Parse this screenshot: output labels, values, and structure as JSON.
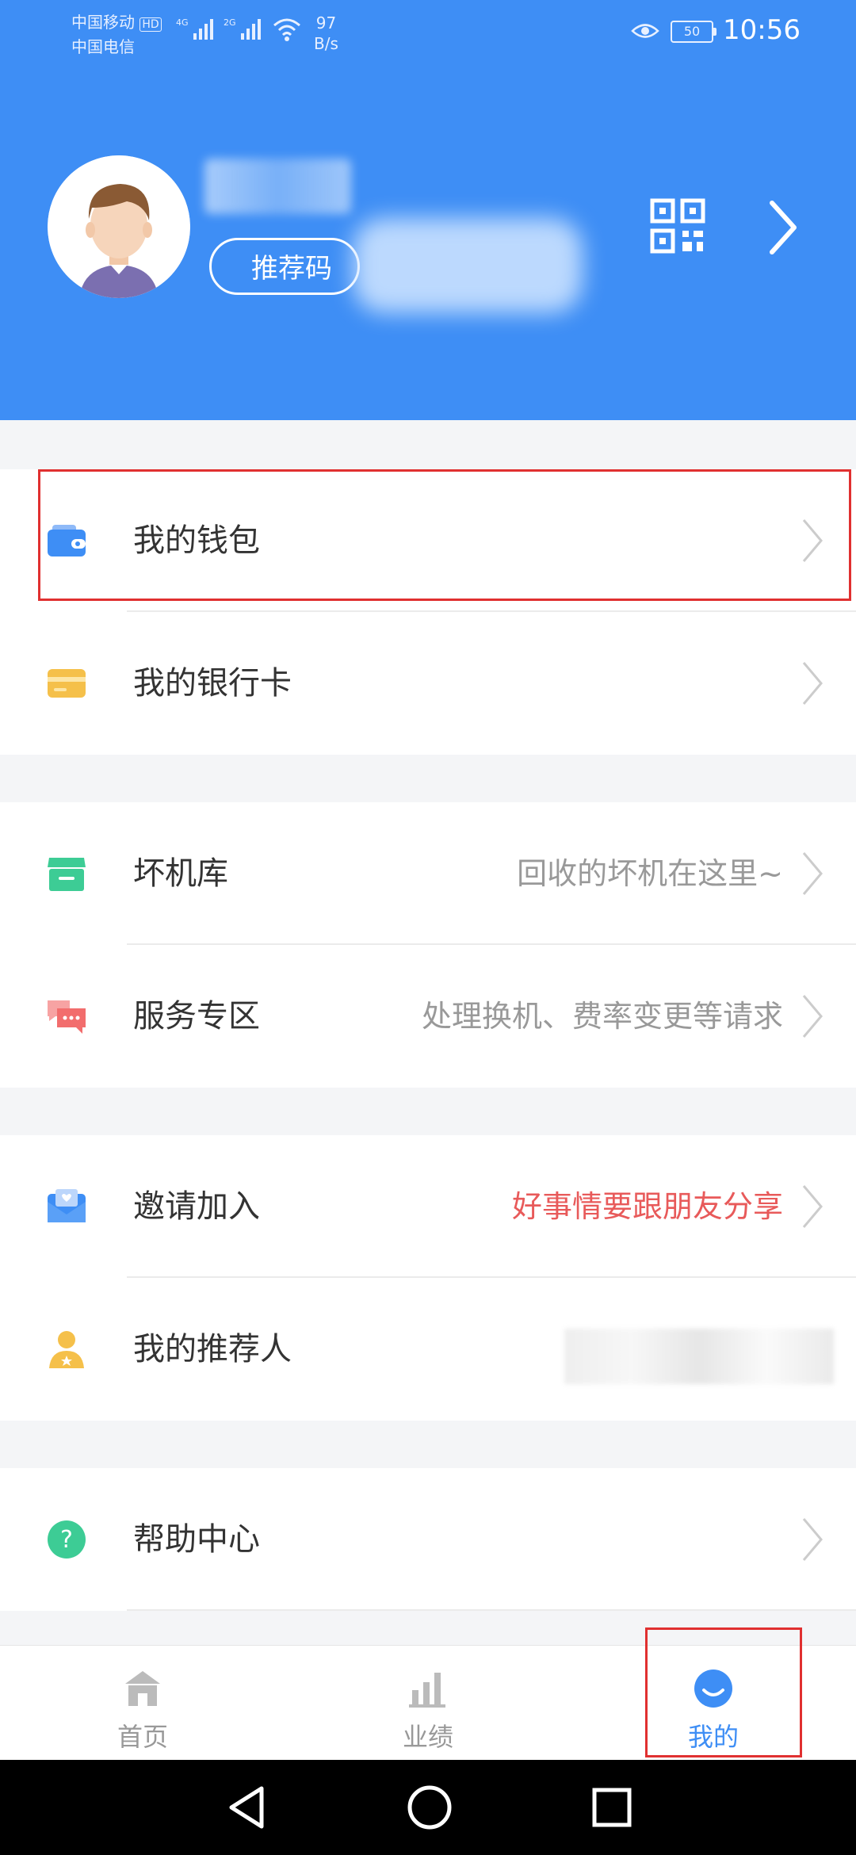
{
  "status_bar": {
    "carrier1": "中国移动",
    "hd_badge": "HD",
    "carrier2": "中国电信",
    "net1": "4G",
    "net2": "2G",
    "speed_value": "97",
    "speed_unit": "B/s",
    "battery": "50",
    "time": "10:56"
  },
  "profile": {
    "referral_label": "推荐码",
    "qr_icon": "qr-code-icon",
    "arrow_icon": "chevron-right-icon"
  },
  "menu": {
    "wallet": {
      "label": "我的钱包",
      "icon": "wallet-icon",
      "color": "#3e8ef5"
    },
    "bank_card": {
      "label": "我的银行卡",
      "icon": "card-icon",
      "color": "#f5c04a"
    },
    "broken_store": {
      "label": "坏机库",
      "hint": "回收的坏机在这里~",
      "icon": "store-icon",
      "color": "#3dcc95"
    },
    "service": {
      "label": "服务专区",
      "hint": "处理换机、费率变更等请求",
      "icon": "chat-icon",
      "color": "#f26d6d"
    },
    "invite": {
      "label": "邀请加入",
      "hint": "好事情要跟朋友分享",
      "icon": "envelope-icon",
      "color": "#3e8ef5",
      "hint_color": "#e85a5a"
    },
    "referrer": {
      "label": "我的推荐人",
      "icon": "person-icon",
      "color": "#f5c04a"
    },
    "help": {
      "label": "帮助中心",
      "icon": "help-icon",
      "color": "#3dcc95"
    }
  },
  "tabs": [
    {
      "label": "首页",
      "icon": "home-icon",
      "active": false
    },
    {
      "label": "业绩",
      "icon": "bar-chart-icon",
      "active": false
    },
    {
      "label": "我的",
      "icon": "smile-icon",
      "active": true
    }
  ],
  "colors": {
    "brand": "#3e8ef5",
    "highlight_box": "#e03030"
  }
}
